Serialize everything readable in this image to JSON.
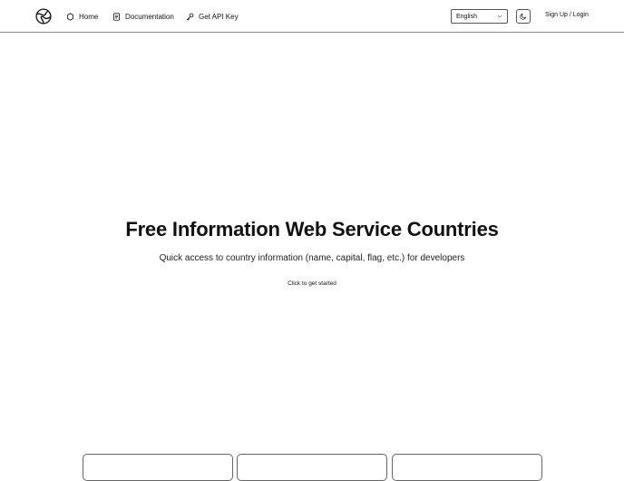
{
  "header": {
    "logo_icon": "globe-icon",
    "nav": [
      {
        "label": "Home",
        "icon": "home-icon"
      },
      {
        "label": "Documentation",
        "icon": "document-icon"
      },
      {
        "label": "Get API Key",
        "icon": "key-icon"
      }
    ],
    "language": {
      "selected": "English",
      "icon": "chevron-down-icon"
    },
    "theme_toggle": {
      "icon": "moon-icon"
    },
    "auth_label": "Sign Up / Login"
  },
  "hero": {
    "title": "Free Information Web Service Countries",
    "subtitle": "Quick access to country information (name, capital, flag, etc.) for developers",
    "cta_label": "Click to get started"
  },
  "cards": [
    {
      "title": ""
    },
    {
      "title": ""
    },
    {
      "title": ""
    }
  ]
}
